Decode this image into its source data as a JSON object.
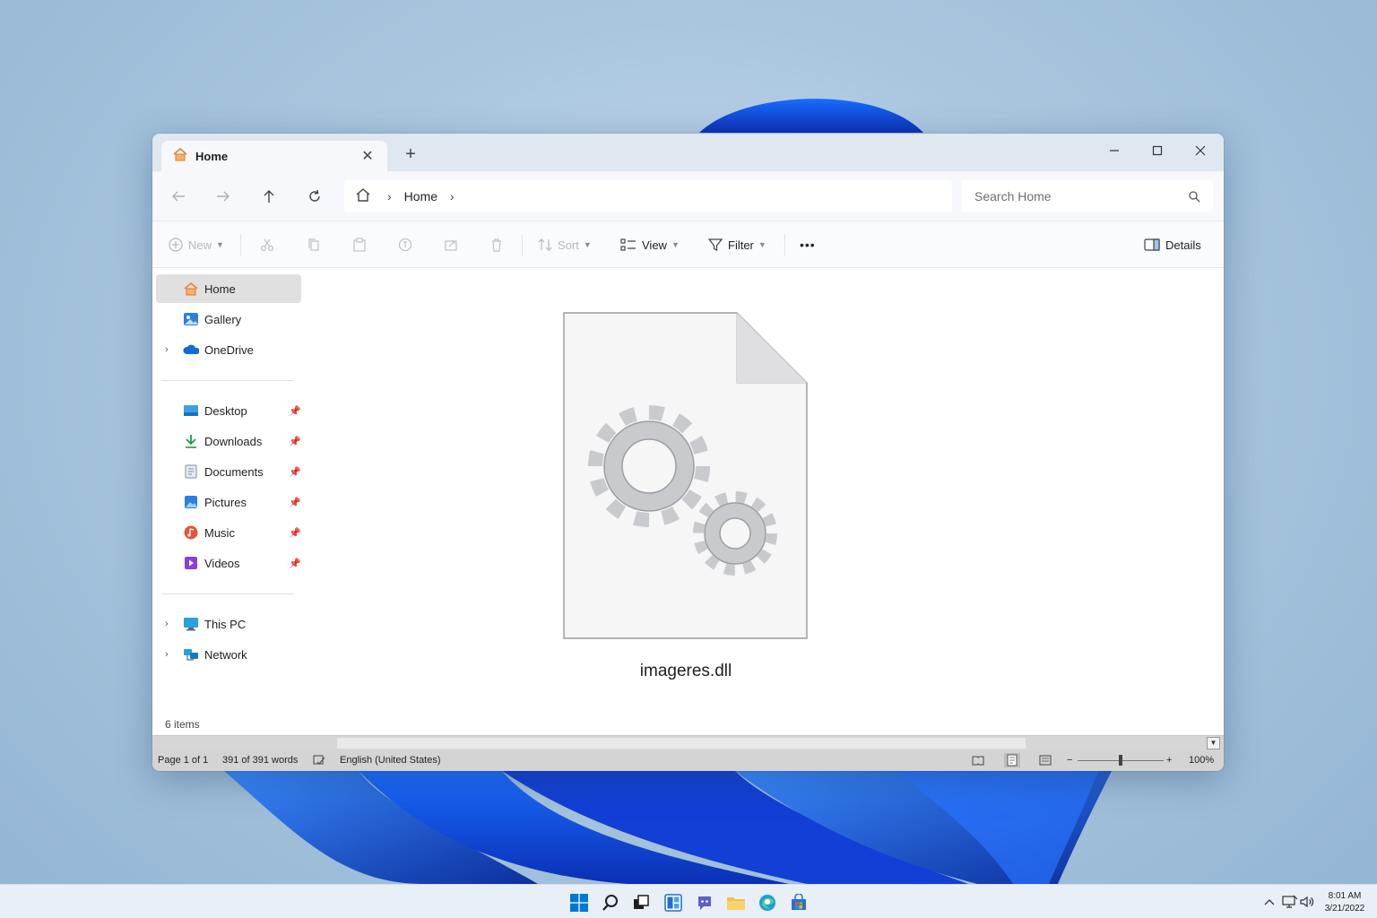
{
  "window": {
    "tab_label": "Home",
    "tab_close": "✕",
    "new_tab": "+",
    "breadcrumb": [
      "Home"
    ],
    "search_placeholder": "Search Home"
  },
  "toolbar": {
    "new_label": "New",
    "sort_label": "Sort",
    "view_label": "View",
    "filter_label": "Filter",
    "more_label": "•••",
    "details_label": "Details"
  },
  "sidebar": {
    "home": "Home",
    "gallery": "Gallery",
    "onedrive": "OneDrive",
    "desktop": "Desktop",
    "downloads": "Downloads",
    "documents": "Documents",
    "pictures": "Pictures",
    "music": "Music",
    "videos": "Videos",
    "this_pc": "This PC",
    "network": "Network"
  },
  "content": {
    "file_name": "imageres.dll",
    "item_count": "6 items"
  },
  "wordbar": {
    "page": "Page 1 of 1",
    "words": "391 of 391 words",
    "language": "English (United States)",
    "zoom_minus": "−",
    "zoom_plus": "+",
    "zoom_level": "100%"
  },
  "taskbar": {
    "time": "8:01 AM",
    "date": "3/21/2022"
  },
  "colors": {
    "accent": "#0067c0",
    "wallpaper_blue": "#1f4fe0",
    "folder_yellow": "#f2c14e"
  }
}
